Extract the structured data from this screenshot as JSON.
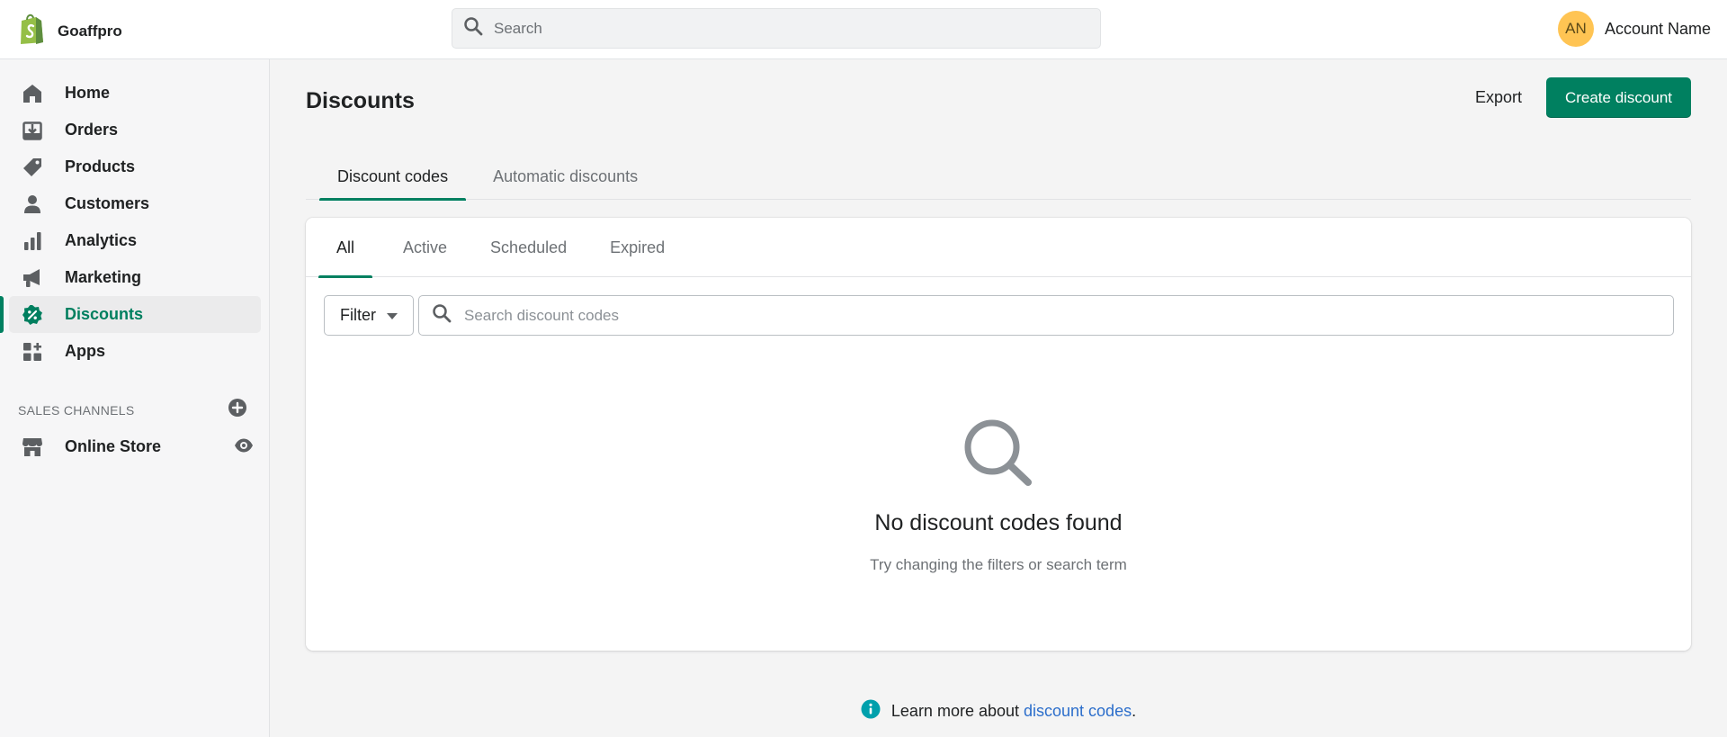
{
  "app": {
    "store_name": "Goaffpro"
  },
  "topbar": {
    "search_placeholder": "Search",
    "account": {
      "initials": "AN",
      "name": "Account Name",
      "avatar_color": "#ffc453"
    }
  },
  "sidebar": {
    "items": [
      {
        "label": "Home",
        "icon": "home-icon"
      },
      {
        "label": "Orders",
        "icon": "orders-icon"
      },
      {
        "label": "Products",
        "icon": "tag-icon"
      },
      {
        "label": "Customers",
        "icon": "person-icon"
      },
      {
        "label": "Analytics",
        "icon": "bar-chart-icon"
      },
      {
        "label": "Marketing",
        "icon": "megaphone-icon"
      },
      {
        "label": "Discounts",
        "icon": "discount-badge-icon",
        "active": true
      },
      {
        "label": "Apps",
        "icon": "apps-grid-icon"
      }
    ],
    "sales_channels": {
      "heading": "SALES CHANNELS",
      "items": [
        {
          "label": "Online Store",
          "icon": "store-icon"
        }
      ]
    }
  },
  "main": {
    "title": "Discounts",
    "export_label": "Export",
    "create_label": "Create discount",
    "tabs": [
      {
        "label": "Discount codes",
        "active": true
      },
      {
        "label": "Automatic discounts"
      }
    ],
    "subtabs": [
      {
        "label": "All",
        "active": true
      },
      {
        "label": "Active"
      },
      {
        "label": "Scheduled"
      },
      {
        "label": "Expired"
      }
    ],
    "filter_label": "Filter",
    "search_placeholder": "Search discount codes",
    "empty_title": "No discount codes found",
    "empty_subtitle": "Try changing the filters or search term",
    "footer": {
      "prefix": "Learn more about ",
      "link": "discount codes",
      "suffix": "."
    }
  },
  "colors": {
    "accent": "#008060",
    "link": "#2c6ecb",
    "info": "#00a0ac"
  }
}
